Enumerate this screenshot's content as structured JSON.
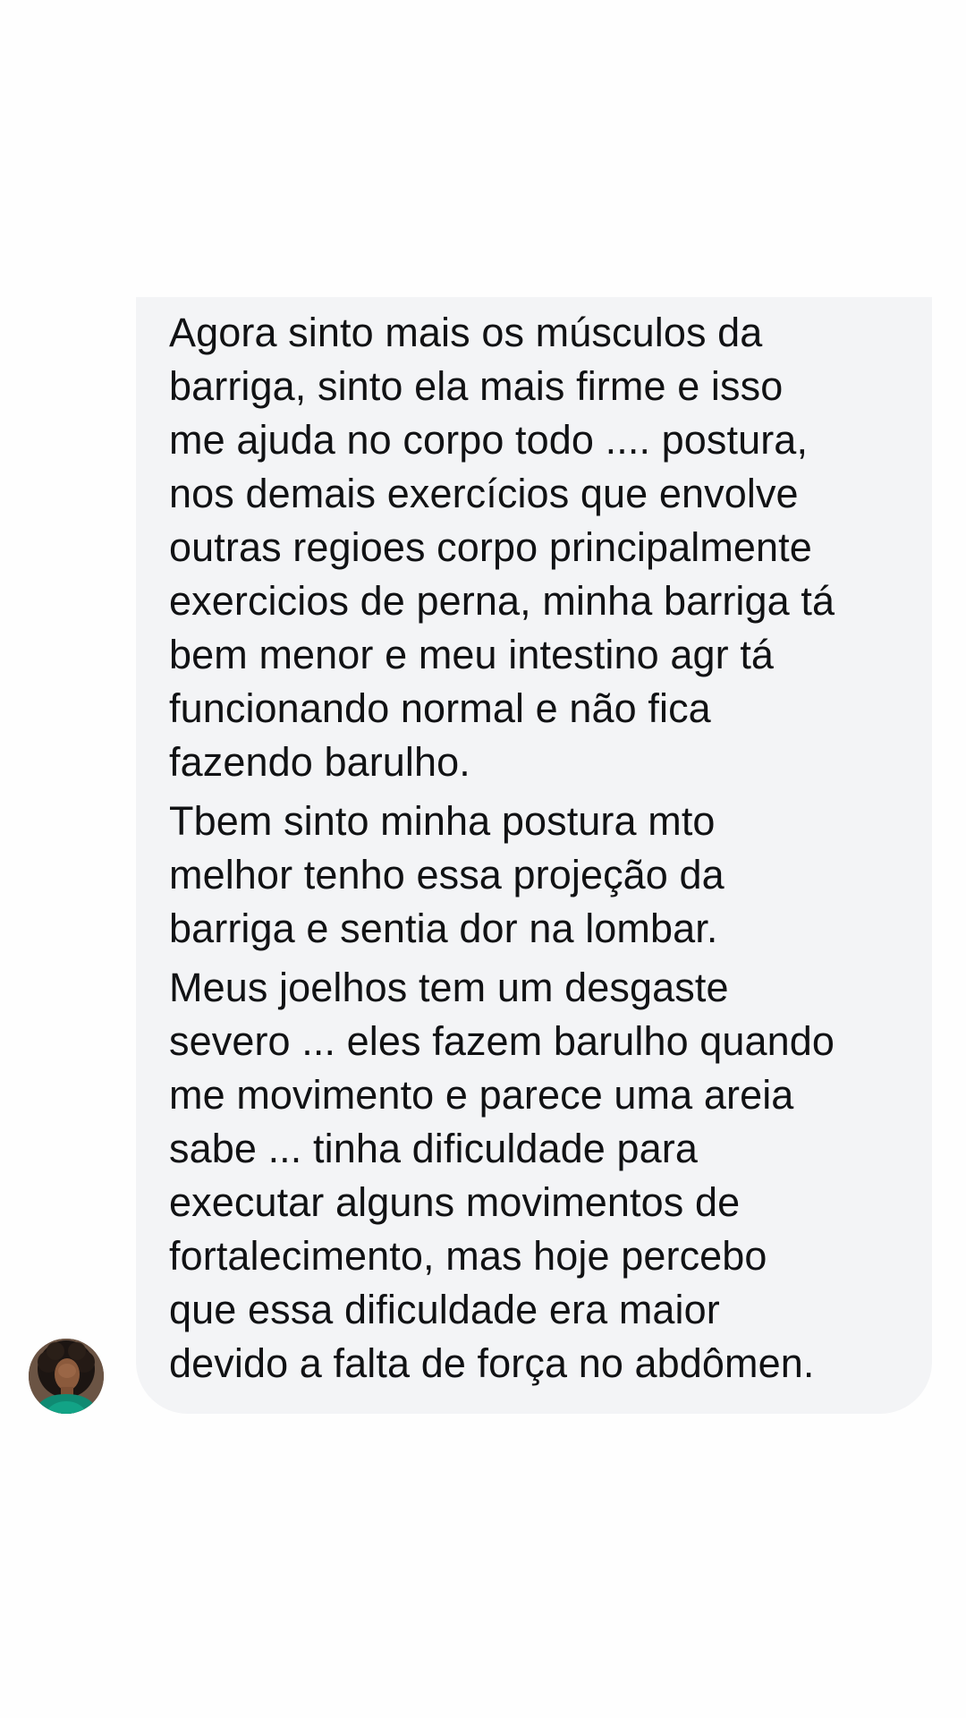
{
  "thread": {
    "message": {
      "paragraphs": [
        "Agora sinto mais os músculos da\nbarriga, sinto ela mais firme e isso\nme ajuda no corpo todo .... postura,\nnos demais exercícios que envolve\noutras regioes corpo principalmente\nexercicios de perna, minha barriga tá\nbem menor e meu intestino agr tá\nfuncionando normal e não fica\nfazendo barulho.",
        "Tbem sinto minha postura mto\nmelhor tenho essa projeção da\nbarriga e sentia dor na lombar.",
        "Meus joelhos tem um desgaste\nsevero ... eles fazem barulho quando\nme movimento e parece uma areia\nsabe ... tinha dificuldade para\nexecutar alguns movimentos de\nfortalecimento, mas hoje percebo\nque essa dificuldade era maior\ndevido a falta de força no abdômen."
      ]
    },
    "sender": {
      "avatar_icon": "profile-photo-avatar"
    }
  },
  "colors": {
    "background": "#fefefe",
    "bubble": "#f3f4f6",
    "text": "#111214"
  }
}
